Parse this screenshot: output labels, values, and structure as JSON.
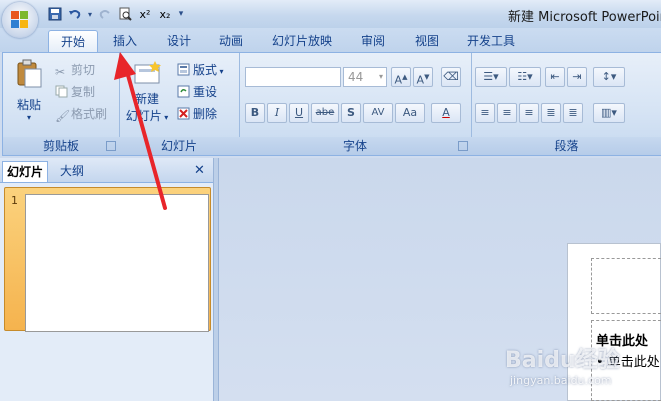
{
  "window": {
    "title": "新建 Microsoft PowerPoint"
  },
  "qat": {
    "icons": [
      "save-icon",
      "undo-icon",
      "redo-icon",
      "print-preview-icon",
      "superscript-icon",
      "subscript-icon",
      "customize-icon"
    ],
    "superscript": "x²",
    "subscript": "x₂"
  },
  "tabs": [
    "开始",
    "插入",
    "设计",
    "动画",
    "幻灯片放映",
    "审阅",
    "视图",
    "开发工具"
  ],
  "active_tab": "开始",
  "ribbon": {
    "clipboard": {
      "label": "剪贴板",
      "paste": "粘贴",
      "cut": "剪切",
      "copy": "复制",
      "format_painter": "格式刷"
    },
    "slides": {
      "label": "幻灯片",
      "new_slide_line1": "新建",
      "new_slide_line2": "幻灯片",
      "layout": "版式",
      "reset": "重设",
      "delete": "删除"
    },
    "font": {
      "label": "字体",
      "font_name": "",
      "font_size": "44",
      "buttons": [
        "B",
        "I",
        "U",
        "abe",
        "S",
        "AV",
        "Aa",
        "A"
      ]
    },
    "paragraph": {
      "label": "段落"
    }
  },
  "panel": {
    "tab_slides": "幻灯片",
    "tab_outline": "大纲",
    "close": "✕",
    "slide_number": "1"
  },
  "slide": {
    "body_title": "单击此处",
    "body_bullet": "• 单击此处"
  },
  "watermark": {
    "text": "Baidu经验",
    "url": "jingyan.baidu.com"
  },
  "colors": {
    "accent": "#15428b",
    "arrow": "#e8252a",
    "ribbon_border": "#8db2e3"
  }
}
